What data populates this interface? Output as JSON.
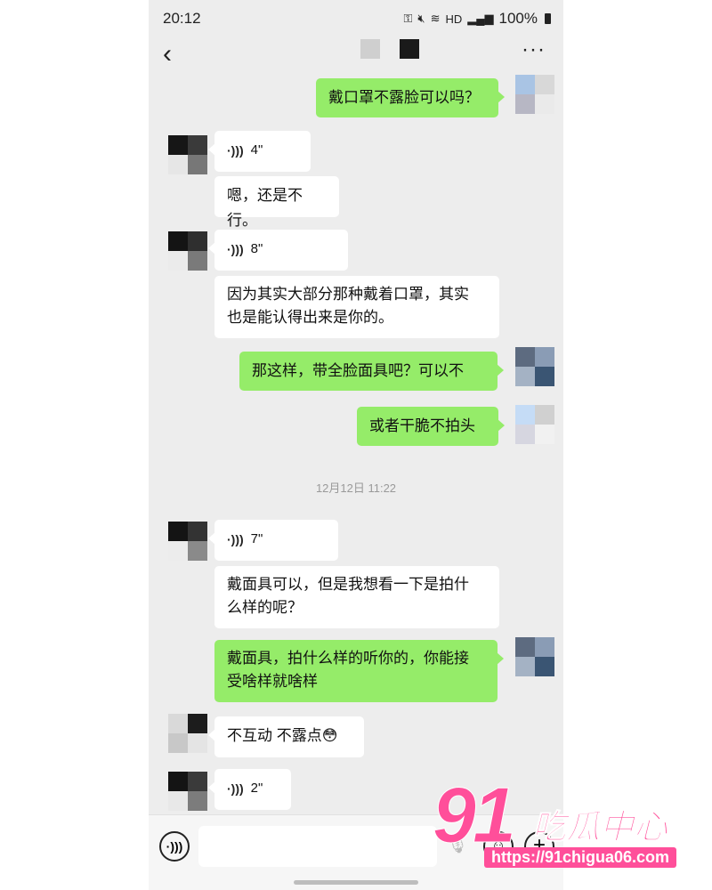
{
  "status_bar": {
    "time": "20:12",
    "battery": "100%",
    "network": "HD"
  },
  "header": {
    "back_icon": "chevron-left-icon",
    "more_icon": "more-dots-icon"
  },
  "messages": [
    {
      "side": "right",
      "type": "text",
      "text": "戴口罩不露脸可以吗？"
    },
    {
      "side": "left",
      "type": "voice",
      "duration": "4\""
    },
    {
      "side": "left",
      "type": "text",
      "text": "嗯，还是不行。"
    },
    {
      "side": "left",
      "type": "voice",
      "duration": "8\""
    },
    {
      "side": "left",
      "type": "text",
      "line1": "因为其实大部分那种戴着口罩，其实",
      "line2": "也是能认得出来是你的。"
    },
    {
      "side": "right",
      "type": "text",
      "text": "那这样，带全脸面具吧？可以不"
    },
    {
      "side": "right",
      "type": "text",
      "text": "或者干脆不拍头"
    },
    {
      "side": "left",
      "type": "voice",
      "duration": "7\""
    },
    {
      "side": "left",
      "type": "text",
      "line1": "戴面具可以，但是我想看一下是拍什",
      "line2": "么样的呢？"
    },
    {
      "side": "right",
      "type": "text",
      "line1": "戴面具，拍什么样的听你的，你能接",
      "line2": "受啥样就啥样"
    },
    {
      "side": "left",
      "type": "text",
      "text": "不互动 不露点😳"
    },
    {
      "side": "left",
      "type": "voice",
      "duration": "2\""
    }
  ],
  "timestamp": "12月12日 11:22",
  "input_bar": {
    "voice_icon": "voice-toggle-icon",
    "emoji_icon": "emoji-icon",
    "plus_icon": "plus-icon"
  },
  "watermark": {
    "number": "91",
    "text": "吃瓜中心",
    "url": "https://91chigua06.com"
  },
  "colors": {
    "chat_bg": "#ededed",
    "outgoing_bubble": "#95ec69",
    "incoming_bubble": "#ffffff",
    "watermark": "#ff4f9a"
  }
}
